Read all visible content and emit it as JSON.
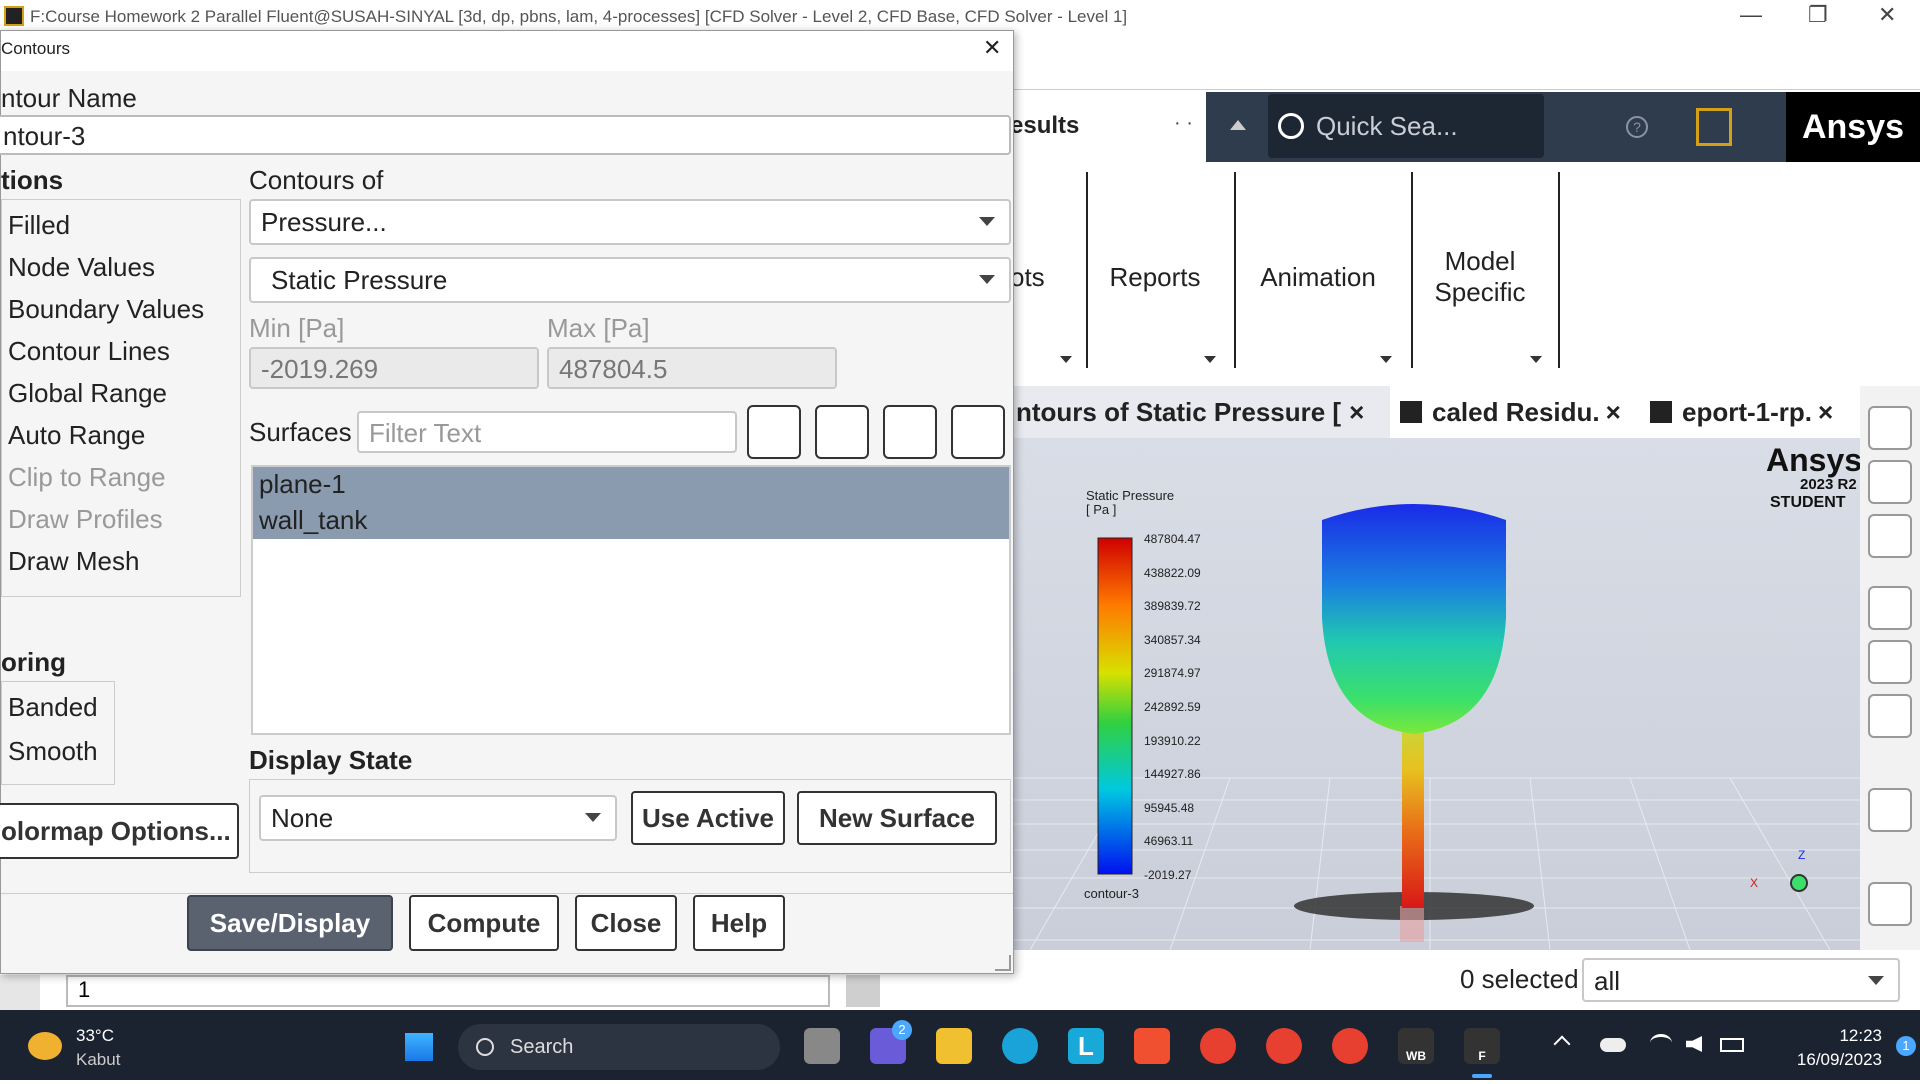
{
  "window": {
    "title": "F:Course Homework 2 Parallel Fluent@SUSAH-SINYAL  [3d, dp, pbns, lam, 4-processes] [CFD Solver - Level 2, CFD Base, CFD Solver - Level 1]",
    "minimize": "—",
    "maximize": "❐",
    "close": "✕"
  },
  "ribbon": {
    "section_title": "esults",
    "search_placeholder": "Quick Sea...",
    "brand": "Ansys",
    "buttons": [
      "ots",
      "Reports",
      "Animation",
      "Model\nSpecific"
    ]
  },
  "tabs": [
    {
      "label": "ntours of Static Pressure [",
      "close": "×"
    },
    {
      "label": "caled Residu.",
      "close": "×"
    },
    {
      "label": "eport-1-rp.",
      "close": "×"
    }
  ],
  "viewport": {
    "watermark_brand": "Ansys",
    "watermark_version": "2023 R2",
    "watermark_edition": "STUDENT",
    "legend_title_1": "Static Pressure",
    "legend_title_2": "[ Pa ]",
    "legend_values": [
      "487804.47",
      "438822.09",
      "389839.72",
      "340857.34",
      "291874.97",
      "242892.59",
      "193910.22",
      "144927.86",
      "95945.48",
      "46963.11",
      "-2019.27"
    ],
    "legend_caption": "contour-3",
    "axis_x": "X",
    "axis_z": "Z"
  },
  "bottom": {
    "selected_text": "0 selected",
    "filter_value": "all",
    "cmd_value": "1"
  },
  "dialog": {
    "title": "Contours",
    "close": "✕",
    "contour_name_label": "ntour Name",
    "contour_name_value": "ntour-3",
    "options_label": "tions",
    "options": [
      {
        "label": "Filled",
        "enabled": true
      },
      {
        "label": "Node Values",
        "enabled": true
      },
      {
        "label": "Boundary Values",
        "enabled": true
      },
      {
        "label": "Contour Lines",
        "enabled": true
      },
      {
        "label": "Global Range",
        "enabled": true
      },
      {
        "label": "Auto Range",
        "enabled": true
      },
      {
        "label": "Clip to Range",
        "enabled": false
      },
      {
        "label": "Draw Profiles",
        "enabled": false
      },
      {
        "label": "Draw Mesh",
        "enabled": true
      }
    ],
    "coloring_label": "oring",
    "coloring": [
      "Banded",
      "Smooth"
    ],
    "colormap_button": "olormap Options...",
    "contours_of_label": "Contours of",
    "contours_of_value": "Pressure...",
    "contours_sub_value": "Static Pressure",
    "min_label": "Min [Pa]",
    "max_label": "Max [Pa]",
    "min_value": "-2019.269",
    "max_value": "487804.5",
    "surfaces_label": "Surfaces",
    "filter_placeholder": "Filter Text",
    "surfaces": [
      "plane-1",
      "wall_tank"
    ],
    "display_state_label": "Display State",
    "display_state_value": "None",
    "use_active": "Use Active",
    "new_surface": "New Surface",
    "save_display": "Save/Display",
    "compute": "Compute",
    "close_btn": "Close",
    "help": "Help"
  },
  "taskbar": {
    "temp": "33°C",
    "weather": "Kabut",
    "search": "Search",
    "time": "12:23",
    "date": "16/09/2023",
    "badge": "2",
    "notif": "1",
    "wb_label": "WB",
    "f_label": "F"
  }
}
